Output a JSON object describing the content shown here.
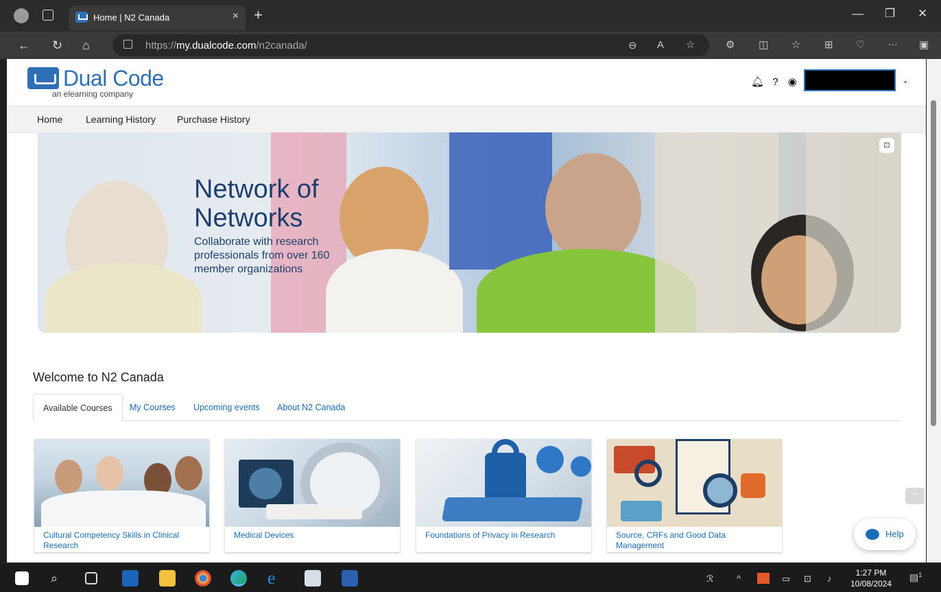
{
  "browser": {
    "tab_title": "Home | N2 Canada",
    "url_prefix": "https://",
    "url_domain": "my.dualcode.com",
    "url_path": "/n2canada/"
  },
  "site": {
    "logo_name": "Dual Code",
    "logo_tag": "an elearning company",
    "nav": [
      "Home",
      "Learning History",
      "Purchase History"
    ]
  },
  "banner": {
    "title": "Network of Networks",
    "subtitle": "Collaborate with research professionals from over 160 member organizations"
  },
  "main": {
    "welcome": "Welcome to N2 Canada",
    "tabs": [
      "Available Courses",
      "My Courses",
      "Upcoming events",
      "About N2 Canada"
    ],
    "active_tab": "Available Courses",
    "courses": [
      "Cultural Competency Skills in Clinical Research",
      "Medical Devices",
      "Foundations of Privacy in Research",
      "Source, CRFs and Good Data Management"
    ],
    "help_label": "Help"
  },
  "taskbar": {
    "time": "1:27 PM",
    "date": "10/08/2024",
    "notification_count": "1"
  },
  "colors": {
    "brand": "#2f6fb5",
    "link": "#1a6db5",
    "banner_text": "#1d3f6e"
  }
}
